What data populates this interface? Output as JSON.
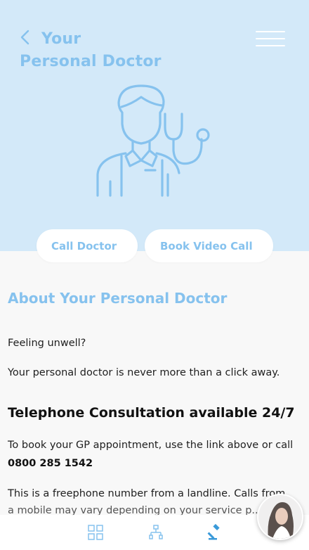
{
  "header": {
    "title_line1": "Your",
    "title_line2": "Personal Doctor",
    "back_icon": "chevron-left-icon",
    "menu_icon": "hamburger-menu-icon"
  },
  "actions": {
    "call_label": "Call Doctor",
    "video_label": "Book Video Call"
  },
  "content": {
    "about_heading": "About Your Personal Doctor",
    "para1": "Feeling unwell?",
    "para2": "Your personal doctor is never more than a click away.",
    "telephone_heading": "Telephone Consultation available 24/7",
    "para3": "To book your GP appointment, use the link above or call",
    "phone": "0800 285 1542",
    "para4": "This is a freephone number from a landline. Calls from",
    "para5": "a mobile may vary depending on your service p..."
  },
  "bottom_nav": {
    "items": [
      "grid-icon",
      "org-chart-icon",
      "gavel-icon"
    ]
  },
  "colors": {
    "hero_bg": "#d3e9f9",
    "accent": "#86c2ee",
    "page_bg": "#f8f8f8"
  }
}
